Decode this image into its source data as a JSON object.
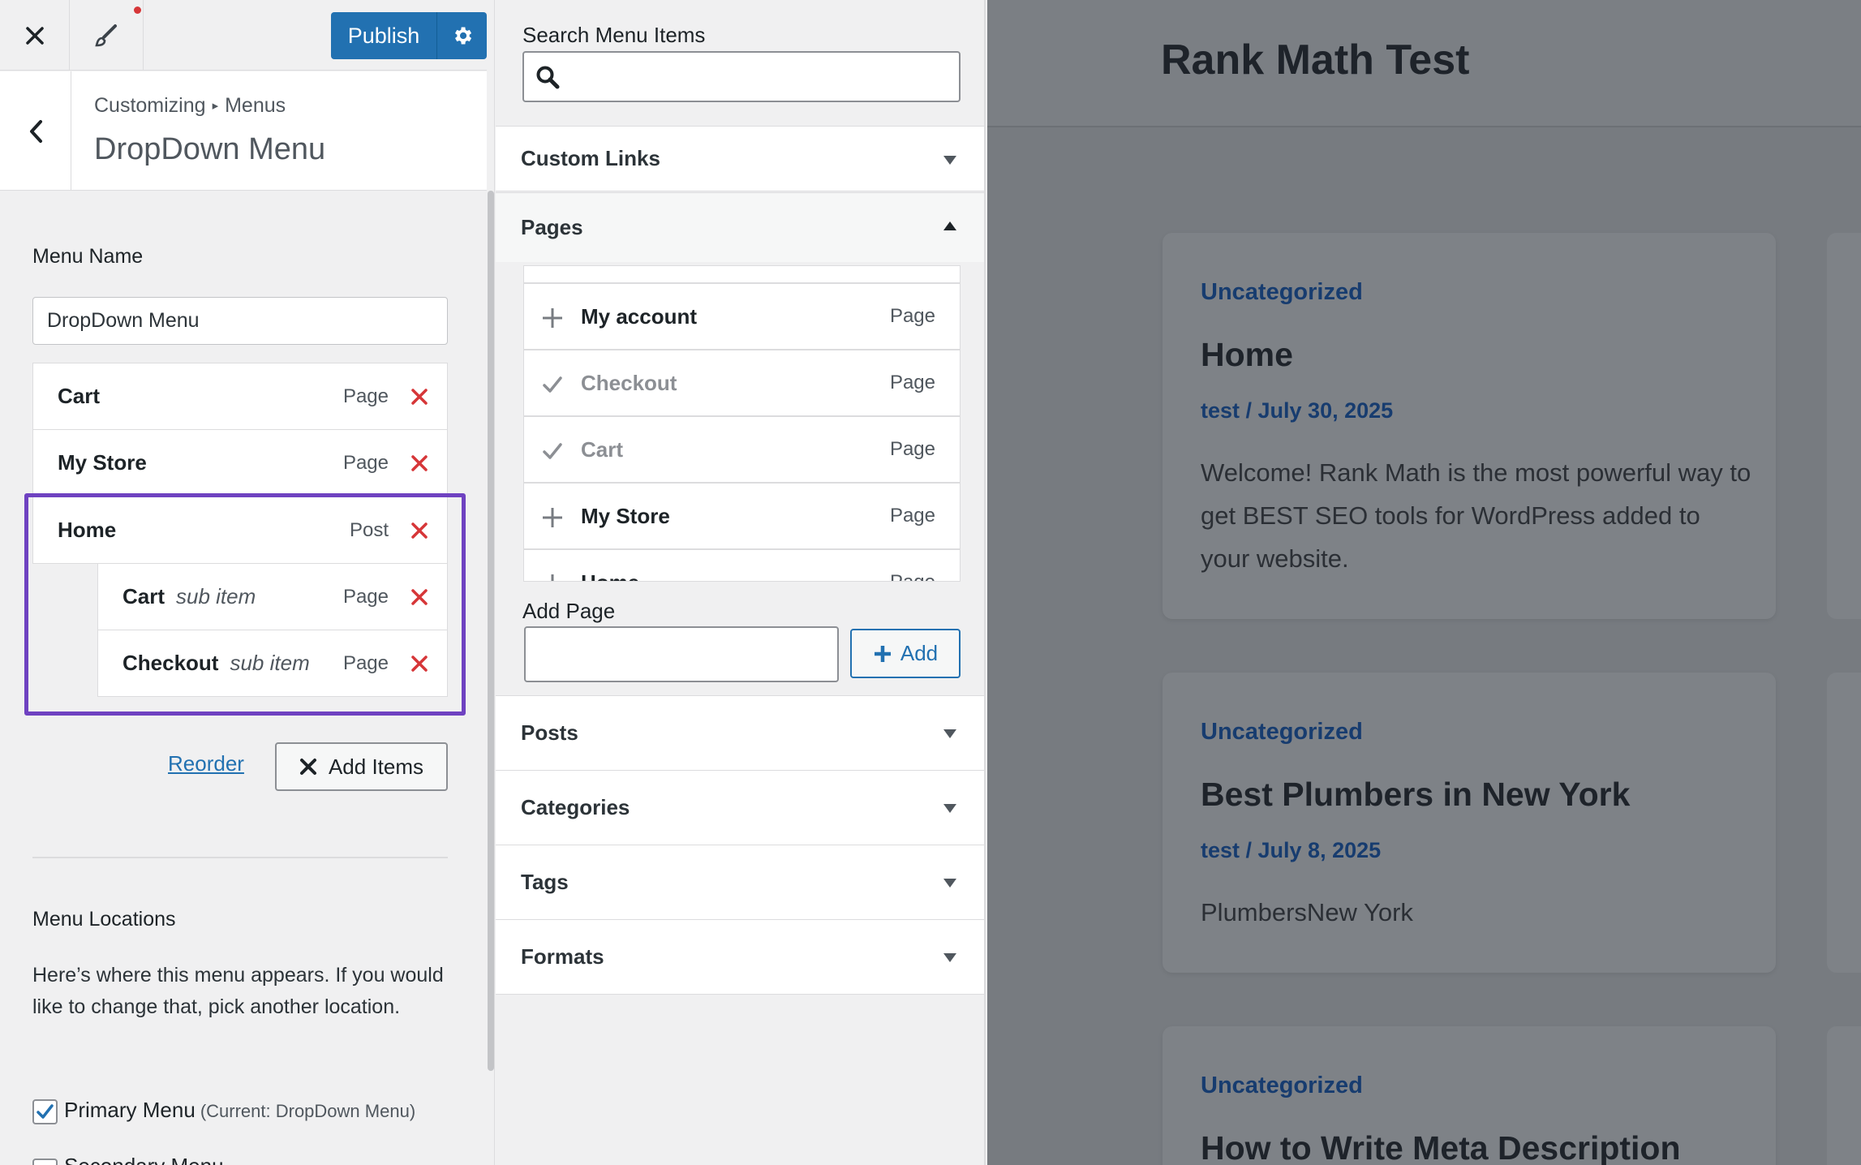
{
  "sidebar": {
    "publish_label": "Publish",
    "breadcrumb_root": "Customizing",
    "breadcrumb_separator": "▸",
    "breadcrumb_section": "Menus",
    "section_title": "DropDown Menu",
    "menu_name_label": "Menu Name",
    "menu_name_value": "DropDown Menu",
    "menu_items": [
      {
        "title": "Cart",
        "sub": "",
        "type": "Page"
      },
      {
        "title": "My Store",
        "sub": "",
        "type": "Page"
      },
      {
        "title": "Home",
        "sub": "",
        "type": "Post"
      },
      {
        "title": "Cart",
        "sub": "sub item",
        "type": "Page"
      },
      {
        "title": "Checkout",
        "sub": "sub item",
        "type": "Page"
      }
    ],
    "reorder_label": "Reorder",
    "add_items_label": "Add Items",
    "locations_title": "Menu Locations",
    "locations_desc": "Here’s where this menu appears. If you would like to change that, pick another location.",
    "primary_label": "Primary Menu",
    "primary_note": "(Current: DropDown Menu)",
    "primary_checked": true,
    "secondary_label": "Secondary Menu",
    "accent_color": "#2271b1",
    "highlight_color": "#6f42c1",
    "remove_color": "#d63638"
  },
  "items_panel": {
    "search_label": "Search Menu Items",
    "search_value": "",
    "sections": {
      "custom_links": "Custom Links",
      "pages": "Pages",
      "posts": "Posts",
      "categories": "Categories",
      "tags": "Tags",
      "formats": "Formats"
    },
    "pages": [
      {
        "title": "My account",
        "type": "Page",
        "added": false
      },
      {
        "title": "Checkout",
        "type": "Page",
        "added": true
      },
      {
        "title": "Cart",
        "type": "Page",
        "added": true
      },
      {
        "title": "My Store",
        "type": "Page",
        "added": false
      },
      {
        "title": "Home",
        "type": "Page",
        "added": false
      }
    ],
    "add_page_label": "Add Page",
    "add_page_value": "",
    "add_button_label": "Add"
  },
  "preview": {
    "site_title": "Rank Math Test",
    "posts": [
      {
        "category": "Uncategorized",
        "title": "Home",
        "meta": "test / July 30, 2025",
        "excerpt": "Welcome! Rank Math is the most powerful way to get BEST SEO tools for WordPress added to your website."
      },
      {
        "category": "Uncategorized",
        "title": "Best Plumbers in New York",
        "meta": "test / July 8, 2025",
        "excerpt": "PlumbersNew York"
      },
      {
        "category": "Uncategorized",
        "title": "How to Write Meta Description",
        "meta": "",
        "excerpt": ""
      }
    ]
  }
}
